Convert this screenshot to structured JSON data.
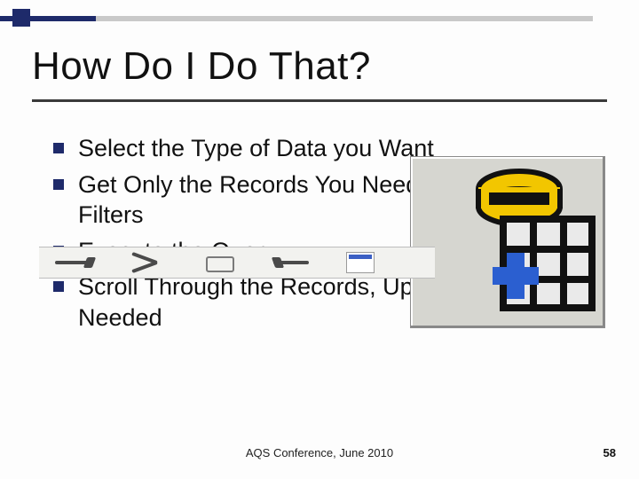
{
  "title": "How Do I Do That?",
  "bullets": {
    "b1": "Select the Type of Data you Want",
    "b2": "Get Only the Records You Need by Specifying Filters",
    "b3": "Execute the Query",
    "b4": "Scroll Through the Records, Updating as Needed"
  },
  "footer": "AQS Conference, June 2010",
  "page": "58"
}
